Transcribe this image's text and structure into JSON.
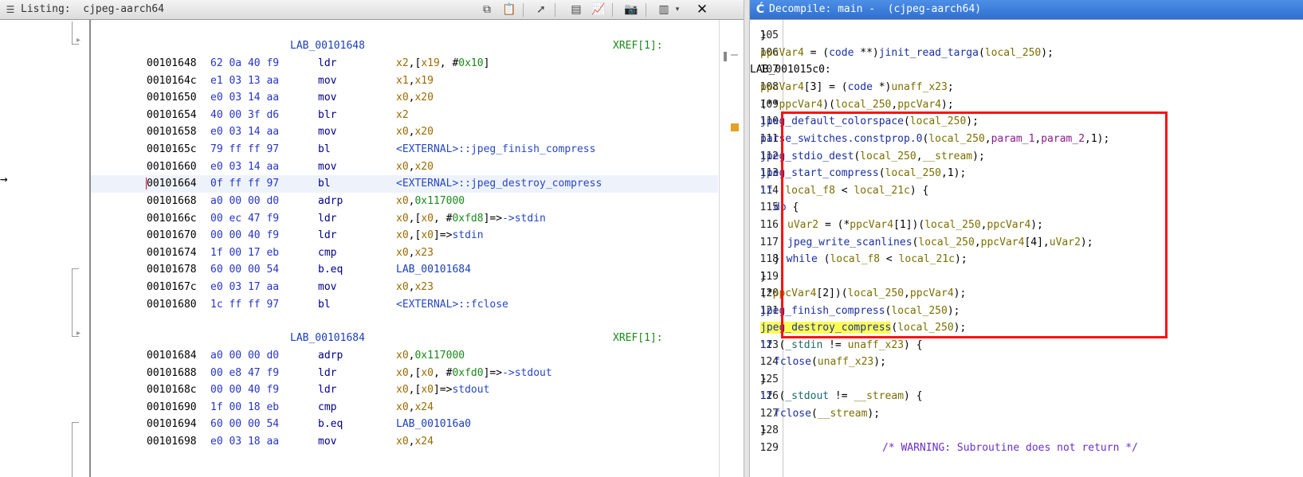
{
  "listing": {
    "title": "Listing:  cjpeg-aarch64",
    "toolbar_icons": [
      "copy-icon",
      "paste-icon",
      "cursor-select-icon",
      "field-layout-icon",
      "diff-graph-icon",
      "snapshot-icon",
      "toggle-panel-icon",
      "dropdown-icon",
      "close-icon"
    ],
    "rows": [
      {
        "type": "label",
        "label": "LAB_00101648",
        "xref": "XREF[1]:"
      },
      {
        "type": "code",
        "addr": "00101648",
        "bytes": "62 0a 40 f9",
        "mnem": "ldr",
        "ops": [
          [
            "reg",
            "x2"
          ],
          [
            "plain",
            ",["
          ],
          [
            "reg",
            "x19"
          ],
          [
            "plain",
            ", #"
          ],
          [
            "num",
            "0x10"
          ],
          [
            "plain",
            "]"
          ]
        ]
      },
      {
        "type": "code",
        "addr": "0010164c",
        "bytes": "e1 03 13 aa",
        "mnem": "mov",
        "ops": [
          [
            "reg",
            "x1"
          ],
          [
            "plain",
            ","
          ],
          [
            "reg",
            "x19"
          ]
        ]
      },
      {
        "type": "code",
        "addr": "00101650",
        "bytes": "e0 03 14 aa",
        "mnem": "mov",
        "ops": [
          [
            "reg",
            "x0"
          ],
          [
            "plain",
            ","
          ],
          [
            "reg",
            "x20"
          ]
        ]
      },
      {
        "type": "code",
        "addr": "00101654",
        "bytes": "40 00 3f d6",
        "mnem": "blr",
        "ops": [
          [
            "reg",
            "x2"
          ]
        ]
      },
      {
        "type": "code",
        "addr": "00101658",
        "bytes": "e0 03 14 aa",
        "mnem": "mov",
        "ops": [
          [
            "reg",
            "x0"
          ],
          [
            "plain",
            ","
          ],
          [
            "reg",
            "x20"
          ]
        ]
      },
      {
        "type": "code",
        "addr": "0010165c",
        "bytes": "79 ff ff 97",
        "mnem": "bl",
        "ops": [
          [
            "ext",
            "<EXTERNAL>::jpeg_finish_compress"
          ]
        ]
      },
      {
        "type": "code",
        "addr": "00101660",
        "bytes": "e0 03 14 aa",
        "mnem": "mov",
        "ops": [
          [
            "reg",
            "x0"
          ],
          [
            "plain",
            ","
          ],
          [
            "reg",
            "x20"
          ]
        ]
      },
      {
        "type": "code",
        "addr": "00101664",
        "bytes": "0f ff ff 97",
        "mnem": "bl",
        "ops": [
          [
            "ext",
            "<EXTERNAL>::jpeg_destroy_compress"
          ]
        ],
        "selected": true
      },
      {
        "type": "code",
        "addr": "00101668",
        "bytes": "a0 00 00 d0",
        "mnem": "adrp",
        "ops": [
          [
            "reg",
            "x0"
          ],
          [
            "plain",
            ","
          ],
          [
            "num",
            "0x117000"
          ]
        ]
      },
      {
        "type": "code",
        "addr": "0010166c",
        "bytes": "00 ec 47 f9",
        "mnem": "ldr",
        "ops": [
          [
            "reg",
            "x0"
          ],
          [
            "plain",
            ",["
          ],
          [
            "reg",
            "x0"
          ],
          [
            "plain",
            ", #"
          ],
          [
            "num",
            "0xfd8"
          ],
          [
            "plain",
            "]=>"
          ],
          [
            "ext",
            "->stdin"
          ]
        ]
      },
      {
        "type": "code",
        "addr": "00101670",
        "bytes": "00 00 40 f9",
        "mnem": "ldr",
        "ops": [
          [
            "reg",
            "x0"
          ],
          [
            "plain",
            ",["
          ],
          [
            "reg",
            "x0"
          ],
          [
            "plain",
            "]=>"
          ],
          [
            "ext",
            "stdin"
          ]
        ]
      },
      {
        "type": "code",
        "addr": "00101674",
        "bytes": "1f 00 17 eb",
        "mnem": "cmp",
        "ops": [
          [
            "reg",
            "x0"
          ],
          [
            "plain",
            ","
          ],
          [
            "reg",
            "x23"
          ]
        ]
      },
      {
        "type": "code",
        "addr": "00101678",
        "bytes": "60 00 00 54",
        "mnem": "b.eq",
        "ops": [
          [
            "lbl",
            "LAB_00101684"
          ]
        ]
      },
      {
        "type": "code",
        "addr": "0010167c",
        "bytes": "e0 03 17 aa",
        "mnem": "mov",
        "ops": [
          [
            "reg",
            "x0"
          ],
          [
            "plain",
            ","
          ],
          [
            "reg",
            "x23"
          ]
        ]
      },
      {
        "type": "code",
        "addr": "00101680",
        "bytes": "1c ff ff 97",
        "mnem": "bl",
        "ops": [
          [
            "ext",
            "<EXTERNAL>::fclose"
          ]
        ]
      },
      {
        "type": "blank"
      },
      {
        "type": "label",
        "label": "LAB_00101684",
        "xref": "XREF[1]:"
      },
      {
        "type": "code",
        "addr": "00101684",
        "bytes": "a0 00 00 d0",
        "mnem": "adrp",
        "ops": [
          [
            "reg",
            "x0"
          ],
          [
            "plain",
            ","
          ],
          [
            "num",
            "0x117000"
          ]
        ]
      },
      {
        "type": "code",
        "addr": "00101688",
        "bytes": "00 e8 47 f9",
        "mnem": "ldr",
        "ops": [
          [
            "reg",
            "x0"
          ],
          [
            "plain",
            ",["
          ],
          [
            "reg",
            "x0"
          ],
          [
            "plain",
            ", #"
          ],
          [
            "num",
            "0xfd0"
          ],
          [
            "plain",
            "]=>"
          ],
          [
            "ext",
            "->stdout"
          ]
        ]
      },
      {
        "type": "code",
        "addr": "0010168c",
        "bytes": "00 00 40 f9",
        "mnem": "ldr",
        "ops": [
          [
            "reg",
            "x0"
          ],
          [
            "plain",
            ",["
          ],
          [
            "reg",
            "x0"
          ],
          [
            "plain",
            "]=>"
          ],
          [
            "ext",
            "stdout"
          ]
        ]
      },
      {
        "type": "code",
        "addr": "00101690",
        "bytes": "1f 00 18 eb",
        "mnem": "cmp",
        "ops": [
          [
            "reg",
            "x0"
          ],
          [
            "plain",
            ","
          ],
          [
            "reg",
            "x24"
          ]
        ]
      },
      {
        "type": "code",
        "addr": "00101694",
        "bytes": "60 00 00 54",
        "mnem": "b.eq",
        "ops": [
          [
            "lbl",
            "LAB_001016a0"
          ]
        ]
      },
      {
        "type": "code",
        "addr": "00101698",
        "bytes": "e0 03 18 aa",
        "mnem": "mov",
        "ops": [
          [
            "reg",
            "x0"
          ],
          [
            "plain",
            ","
          ],
          [
            "reg",
            "x24"
          ]
        ]
      }
    ]
  },
  "decompile": {
    "title": "Decompile: main -  (cjpeg-aarch64)",
    "lines": [
      {
        "n": "105",
        "i": 1,
        "s": [
          [
            "o",
            "}"
          ]
        ]
      },
      {
        "n": "106",
        "i": 1,
        "s": [
          [
            "v",
            "ppcVar4"
          ],
          [
            "o",
            " = ("
          ],
          [
            "t",
            "code"
          ],
          [
            "o",
            " **)"
          ],
          [
            "f",
            "jinit_read_targa"
          ],
          [
            "o",
            "("
          ],
          [
            "v",
            "local_250"
          ],
          [
            "o",
            ");"
          ]
        ]
      },
      {
        "n": "107",
        "i": 0,
        "s": [
          [
            "o",
            "LAB_001015c0:"
          ]
        ]
      },
      {
        "n": "108",
        "i": 1,
        "s": [
          [
            "v",
            "ppcVar4"
          ],
          [
            "o",
            "[3] = ("
          ],
          [
            "t",
            "code"
          ],
          [
            "o",
            " *)"
          ],
          [
            "v",
            "unaff_x23"
          ],
          [
            "o",
            ";"
          ]
        ]
      },
      {
        "n": "109",
        "i": 1,
        "s": [
          [
            "o",
            "(**"
          ],
          [
            "v",
            "ppcVar4"
          ],
          [
            "o",
            ")("
          ],
          [
            "v",
            "local_250"
          ],
          [
            "o",
            ","
          ],
          [
            "v",
            "ppcVar4"
          ],
          [
            "o",
            ");"
          ]
        ]
      },
      {
        "n": "110",
        "i": 1,
        "s": [
          [
            "f",
            "jpeg_default_colorspace"
          ],
          [
            "o",
            "("
          ],
          [
            "v",
            "local_250"
          ],
          [
            "o",
            ");"
          ]
        ]
      },
      {
        "n": "111",
        "i": 1,
        "s": [
          [
            "f",
            "parse_switches.constprop.0"
          ],
          [
            "o",
            "("
          ],
          [
            "v",
            "local_250"
          ],
          [
            "o",
            ","
          ],
          [
            "p",
            "param_1"
          ],
          [
            "o",
            ","
          ],
          [
            "p",
            "param_2"
          ],
          [
            "o",
            ",1);"
          ]
        ]
      },
      {
        "n": "112",
        "i": 1,
        "s": [
          [
            "f",
            "jpeg_stdio_dest"
          ],
          [
            "o",
            "("
          ],
          [
            "v",
            "local_250"
          ],
          [
            "o",
            ","
          ],
          [
            "v",
            "__stream"
          ],
          [
            "o",
            ");"
          ]
        ]
      },
      {
        "n": "113",
        "i": 1,
        "s": [
          [
            "f",
            "jpeg_start_compress"
          ],
          [
            "o",
            "("
          ],
          [
            "v",
            "local_250"
          ],
          [
            "o",
            ",1);"
          ]
        ]
      },
      {
        "n": "114",
        "i": 1,
        "s": [
          [
            "k",
            "if"
          ],
          [
            "o",
            " ("
          ],
          [
            "v",
            "local_f8"
          ],
          [
            "o",
            " < "
          ],
          [
            "v",
            "local_21c"
          ],
          [
            "o",
            ") {"
          ]
        ]
      },
      {
        "n": "115",
        "i": 2,
        "s": [
          [
            "k",
            "do"
          ],
          [
            "o",
            " {"
          ]
        ]
      },
      {
        "n": "116",
        "i": 3,
        "s": [
          [
            "v",
            "uVar2"
          ],
          [
            "o",
            " = (*"
          ],
          [
            "v",
            "ppcVar4"
          ],
          [
            "o",
            "[1])("
          ],
          [
            "v",
            "local_250"
          ],
          [
            "o",
            ","
          ],
          [
            "v",
            "ppcVar4"
          ],
          [
            "o",
            ");"
          ]
        ]
      },
      {
        "n": "117",
        "i": 3,
        "s": [
          [
            "f",
            "jpeg_write_scanlines"
          ],
          [
            "o",
            "("
          ],
          [
            "v",
            "local_250"
          ],
          [
            "o",
            ","
          ],
          [
            "v",
            "ppcVar4"
          ],
          [
            "o",
            "[4],"
          ],
          [
            "v",
            "uVar2"
          ],
          [
            "o",
            ");"
          ]
        ]
      },
      {
        "n": "118",
        "i": 2,
        "s": [
          [
            "o",
            "} "
          ],
          [
            "k",
            "while"
          ],
          [
            "o",
            " ("
          ],
          [
            "v",
            "local_f8"
          ],
          [
            "o",
            " < "
          ],
          [
            "v",
            "local_21c"
          ],
          [
            "o",
            ");"
          ]
        ]
      },
      {
        "n": "119",
        "i": 1,
        "s": [
          [
            "o",
            "}"
          ]
        ]
      },
      {
        "n": "120",
        "i": 1,
        "s": [
          [
            "o",
            "(*"
          ],
          [
            "v",
            "ppcVar4"
          ],
          [
            "o",
            "[2])("
          ],
          [
            "v",
            "local_250"
          ],
          [
            "o",
            ","
          ],
          [
            "v",
            "ppcVar4"
          ],
          [
            "o",
            ");"
          ]
        ]
      },
      {
        "n": "121",
        "i": 1,
        "s": [
          [
            "f",
            "jpeg_finish_compress"
          ],
          [
            "o",
            "("
          ],
          [
            "v",
            "local_250"
          ],
          [
            "o",
            ");"
          ]
        ]
      },
      {
        "n": "122",
        "i": 1,
        "s": [
          [
            "fh",
            "jpeg_destroy_compress"
          ],
          [
            "o",
            "("
          ],
          [
            "v",
            "local_250"
          ],
          [
            "o",
            ");"
          ]
        ]
      },
      {
        "n": "123",
        "i": 1,
        "s": [
          [
            "k",
            "if"
          ],
          [
            "o",
            " ("
          ],
          [
            "g",
            "_stdin"
          ],
          [
            "o",
            " != "
          ],
          [
            "v",
            "unaff_x23"
          ],
          [
            "o",
            ") {"
          ]
        ]
      },
      {
        "n": "124",
        "i": 2,
        "s": [
          [
            "f",
            "fclose"
          ],
          [
            "o",
            "("
          ],
          [
            "v",
            "unaff_x23"
          ],
          [
            "o",
            ");"
          ]
        ]
      },
      {
        "n": "125",
        "i": 1,
        "s": [
          [
            "o",
            "}"
          ]
        ]
      },
      {
        "n": "126",
        "i": 1,
        "s": [
          [
            "k",
            "if"
          ],
          [
            "o",
            " ("
          ],
          [
            "g",
            "_stdout"
          ],
          [
            "o",
            " != "
          ],
          [
            "v",
            "__stream"
          ],
          [
            "o",
            ") {"
          ]
        ]
      },
      {
        "n": "127",
        "i": 2,
        "s": [
          [
            "f",
            "fclose"
          ],
          [
            "o",
            "("
          ],
          [
            "v",
            "__stream"
          ],
          [
            "o",
            ");"
          ]
        ]
      },
      {
        "n": "128",
        "i": 1,
        "s": [
          [
            "o",
            "}"
          ]
        ]
      },
      {
        "n": "129",
        "i": 9,
        "s": [
          [
            "c",
            "/* WARNING: Subroutine does not return */"
          ]
        ]
      }
    ]
  }
}
